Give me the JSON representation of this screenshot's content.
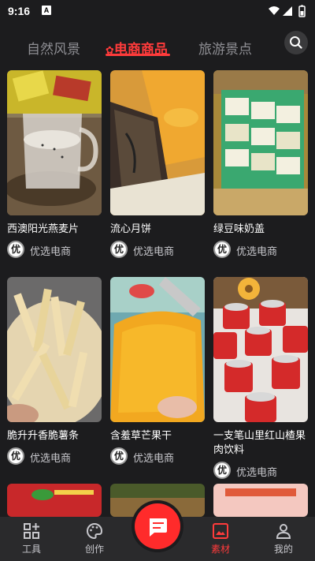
{
  "status": {
    "time": "9:16",
    "a_icon": "A"
  },
  "tabs": [
    {
      "label": "自然风景",
      "active": false
    },
    {
      "label": "电商商品",
      "active": true,
      "prefix_icon": "flower-icon"
    },
    {
      "label": "旅游景点",
      "active": false
    }
  ],
  "cards": [
    {
      "title": "西澳阳光燕麦片",
      "shop": "优选电商",
      "logo": "优"
    },
    {
      "title": "流心月饼",
      "shop": "优选电商",
      "logo": "优"
    },
    {
      "title": "绿豆味奶盖",
      "shop": "优选电商",
      "logo": "优"
    },
    {
      "title": "脆升升香脆薯条",
      "shop": "优选电商",
      "logo": "优"
    },
    {
      "title": "含羞草芒果干",
      "shop": "优选电商",
      "logo": "优"
    },
    {
      "title": "一支笔山里红山楂果肉饮料",
      "shop": "优选电商",
      "logo": "优"
    }
  ],
  "nav": [
    {
      "label": "工具",
      "icon": "grid-plus-icon",
      "active": false
    },
    {
      "label": "创作",
      "icon": "palette-icon",
      "active": false
    },
    {
      "label": "素材",
      "icon": "image-icon",
      "active": true
    },
    {
      "label": "我的",
      "icon": "person-icon",
      "active": false
    }
  ],
  "colors": {
    "accent": "#ff3b3b",
    "background": "#1c1c1e",
    "nav_bg": "#2a2a2c"
  }
}
